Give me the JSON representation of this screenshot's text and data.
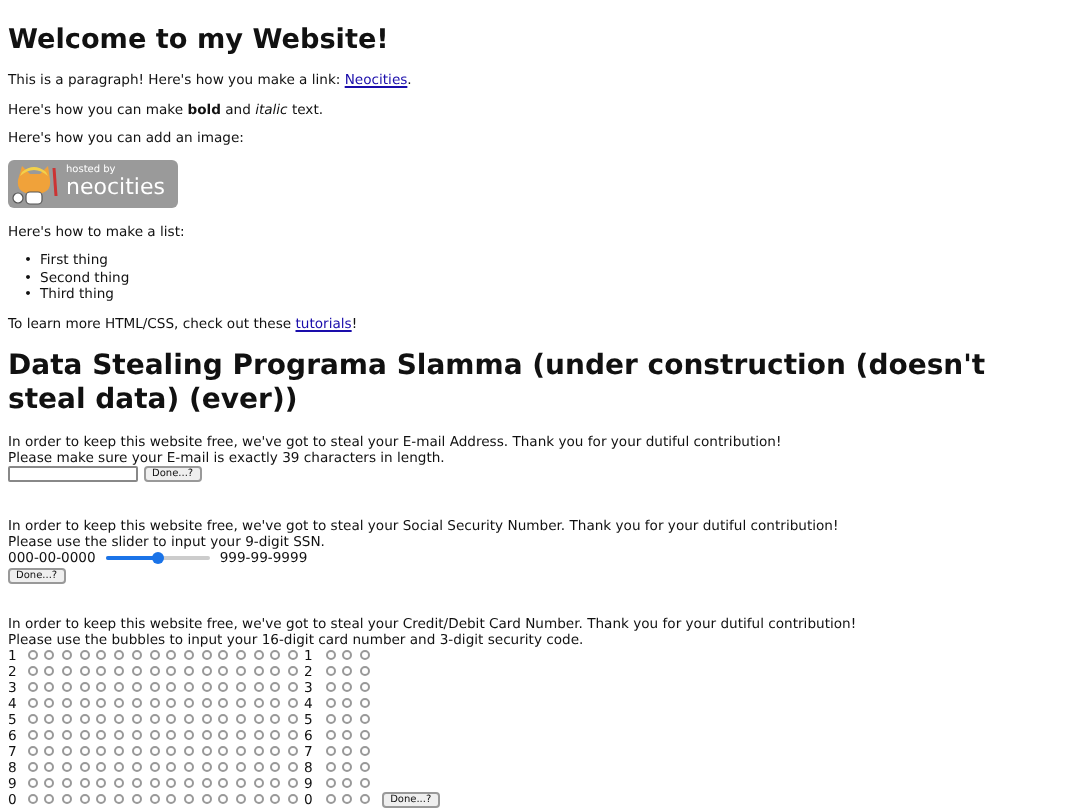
{
  "heading": "Welcome to my Website!",
  "intro": [
    {
      "text": "This is a paragraph! Here's how you make a link: ",
      "link": "Neocities",
      "after": "."
    },
    {
      "text": "Here's how you can make **bold** and *italic* text."
    },
    {
      "text": "Here's how you can add an image:"
    }
  ],
  "badge": {
    "kind": "picture",
    "line_1": "hosted by",
    "line_2": "neocities"
  },
  "list_intro": "Here's how to make a list:",
  "list": [
    {
      "marker": "•",
      "text": "First thing"
    },
    {
      "marker": "•",
      "text": "Second thing"
    },
    {
      "marker": "•",
      "text": "Third thing"
    }
  ],
  "outro": {
    "text": "To learn more HTML/CSS, check out these ",
    "link": "tutorials",
    "after": "!"
  },
  "heading_2": "Data Stealing Programa Slamma (under construction (doesn't steal data) (ever))",
  "email": {
    "lines": [
      "In order to keep this website free, we've got to steal your E-mail Address. Thank you for your dutiful contribution!",
      "Please make sure your E-mail is exactly 39 characters in length."
    ],
    "button": "Done...?"
  },
  "ssn": {
    "lines": [
      "In order to keep this website free, we've got to steal your Social Security Number. Thank you for your dutiful contribution!",
      "Please use the slider to input your 9-digit SSN."
    ],
    "min": "000-00-0000",
    "max": "999-99-9999",
    "level": 0.5,
    "button": "Done...?"
  },
  "card": {
    "lines": [
      "In order to keep this website free, we've got to steal your Credit/Debit Card Number. Thank you for your dutiful contribution!",
      "Please use the bubbles to input your 16-digit card number and 3-digit security code."
    ],
    "button": "Done...?",
    "rows": [
      {
        "label": "1",
        "code_label": "1",
        "card": [
          false,
          false,
          false,
          false,
          false,
          false,
          false,
          false,
          false,
          false,
          false,
          false,
          false,
          false,
          false,
          false
        ],
        "code": [
          false,
          false,
          false
        ]
      },
      {
        "label": "2",
        "code_label": "2",
        "card": [
          false,
          false,
          false,
          false,
          false,
          false,
          false,
          false,
          false,
          false,
          false,
          false,
          false,
          false,
          false,
          false
        ],
        "code": [
          false,
          false,
          false
        ]
      },
      {
        "label": "3",
        "code_label": "3",
        "card": [
          false,
          false,
          false,
          false,
          false,
          false,
          false,
          false,
          false,
          false,
          false,
          false,
          false,
          false,
          false,
          false
        ],
        "code": [
          false,
          false,
          false
        ]
      },
      {
        "label": "4",
        "code_label": "4",
        "card": [
          false,
          false,
          false,
          false,
          false,
          false,
          false,
          false,
          false,
          false,
          false,
          false,
          false,
          false,
          false,
          false
        ],
        "code": [
          false,
          false,
          false
        ]
      },
      {
        "label": "5",
        "code_label": "5",
        "card": [
          false,
          false,
          false,
          false,
          false,
          false,
          false,
          false,
          false,
          false,
          false,
          false,
          false,
          false,
          false,
          false
        ],
        "code": [
          false,
          false,
          false
        ]
      },
      {
        "label": "6",
        "code_label": "6",
        "card": [
          false,
          false,
          false,
          false,
          false,
          false,
          false,
          false,
          false,
          false,
          false,
          false,
          false,
          false,
          false,
          false
        ],
        "code": [
          false,
          false,
          false
        ]
      },
      {
        "label": "7",
        "code_label": "7",
        "card": [
          false,
          false,
          false,
          false,
          false,
          false,
          false,
          false,
          false,
          false,
          false,
          false,
          false,
          false,
          false,
          false
        ],
        "code": [
          false,
          false,
          false
        ]
      },
      {
        "label": "8",
        "code_label": "8",
        "card": [
          false,
          false,
          false,
          false,
          false,
          false,
          false,
          false,
          false,
          false,
          false,
          false,
          false,
          false,
          false,
          false
        ],
        "code": [
          false,
          false,
          false
        ]
      },
      {
        "label": "9",
        "code_label": "9",
        "card": [
          false,
          false,
          false,
          false,
          false,
          false,
          false,
          false,
          false,
          false,
          false,
          false,
          false,
          false,
          false,
          false
        ],
        "code": [
          false,
          false,
          false
        ]
      },
      {
        "label": "0",
        "code_label": "0",
        "card": [
          false,
          false,
          false,
          false,
          false,
          false,
          false,
          false,
          false,
          false,
          false,
          false,
          false,
          false,
          false,
          false
        ],
        "code": [
          false,
          false,
          false
        ]
      }
    ]
  }
}
